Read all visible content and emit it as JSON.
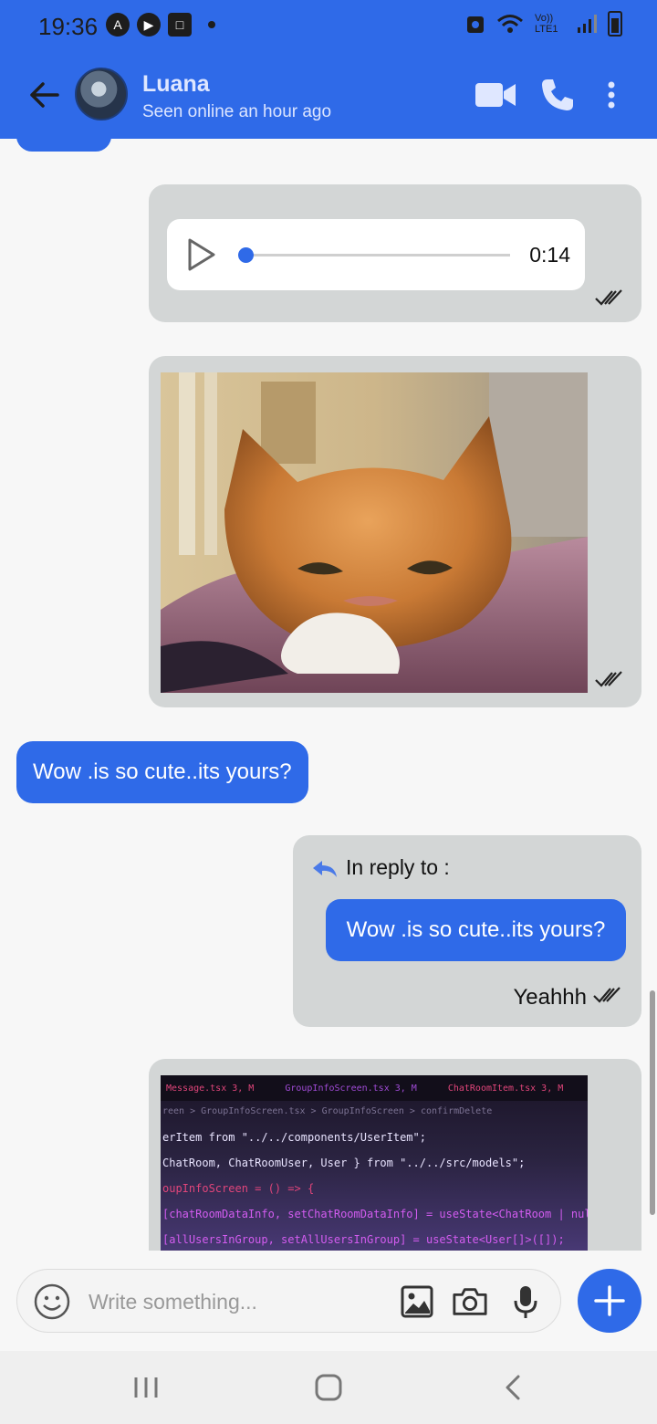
{
  "status_bar": {
    "time": "19:36",
    "network_label": "Vo)) LTE1"
  },
  "header": {
    "contact_name": "Luana",
    "contact_status": "Seen online an hour ago",
    "icons": [
      "back-arrow-icon",
      "video-call-icon",
      "phone-icon",
      "more-vertical-icon"
    ]
  },
  "messages": {
    "audio": {
      "duration": "0:14",
      "progress": 0.0
    },
    "incoming_text": "Wow .is so cute..its yours?",
    "reply": {
      "label": "In reply to :",
      "quoted_text": "Wow .is so cute..its yours?",
      "text": "Yeahhh"
    },
    "code_lines": [
      "erItem from \"../../components/UserItem\";",
      "ChatRoom, ChatRoomUser, User } from \"../../src/models\";",
      "oupInfoScreen = () => {",
      "[chatRoomDataInfo, setChatRoomDataInfo] = useState<ChatRoom | null>(",
      "[allUsersInGroup, setAllUsersInGroup] = useState<User[]>([]);"
    ],
    "code_tabs": [
      "Message.tsx 3, M",
      "GroupInfoScreen.tsx 3, M",
      "ChatRoomItem.tsx 3, M"
    ],
    "code_breadcrumb": "reen > GroupInfoScreen.tsx > GroupInfoScreen > confirmDelete"
  },
  "composer": {
    "placeholder": "Write something..."
  },
  "colors": {
    "accent": "#2f6ae8",
    "outgoing_bubble": "#d3d6d6"
  }
}
